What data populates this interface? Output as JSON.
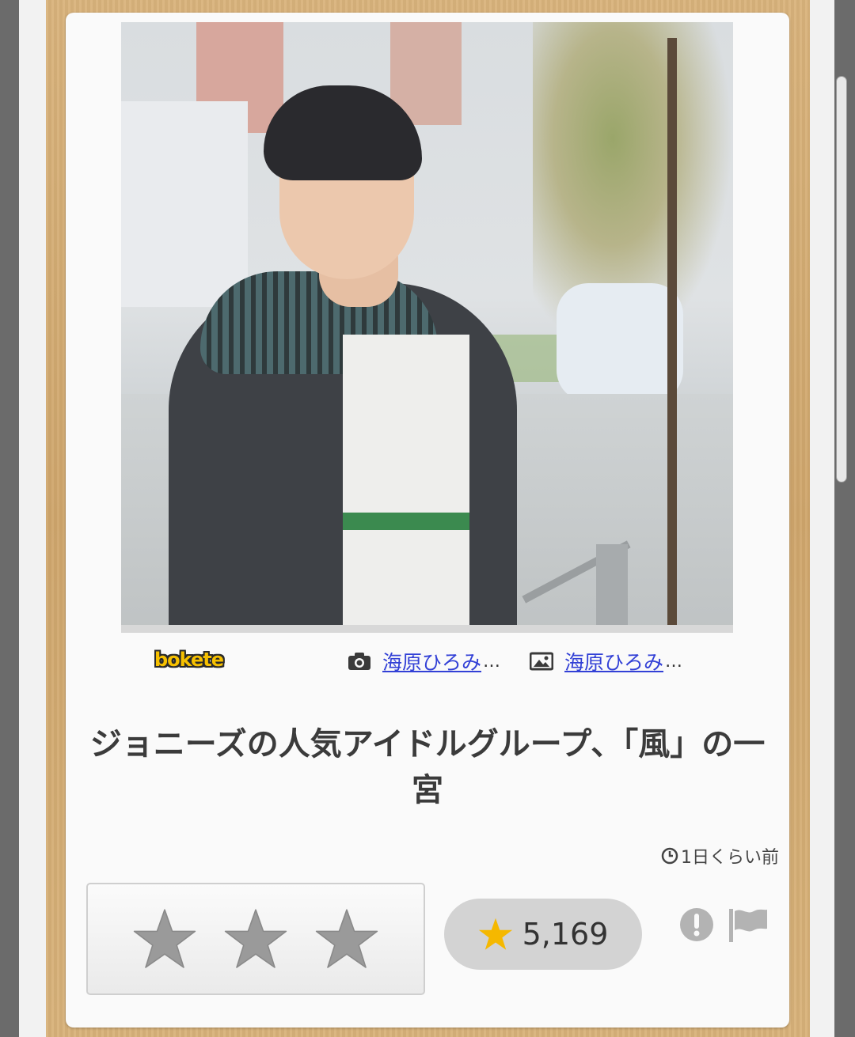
{
  "photo": {
    "alt": "",
    "logo_text": "bokete"
  },
  "credits": [
    {
      "icon": "camera-icon",
      "name": "海原ひろみ",
      "suffix": "…"
    },
    {
      "icon": "image-icon",
      "name": "海原ひろみ",
      "suffix": "…"
    }
  ],
  "post": {
    "title": "ジョニーズの人気アイドルグループ、「風」の一宮",
    "time_ago": "1日くらい前"
  },
  "rating": {
    "stars": 3,
    "score_label": "5,169"
  },
  "colors": {
    "star_gold": "#f5b800",
    "star_gray": "#9a9a9a",
    "link": "#3240d6"
  }
}
